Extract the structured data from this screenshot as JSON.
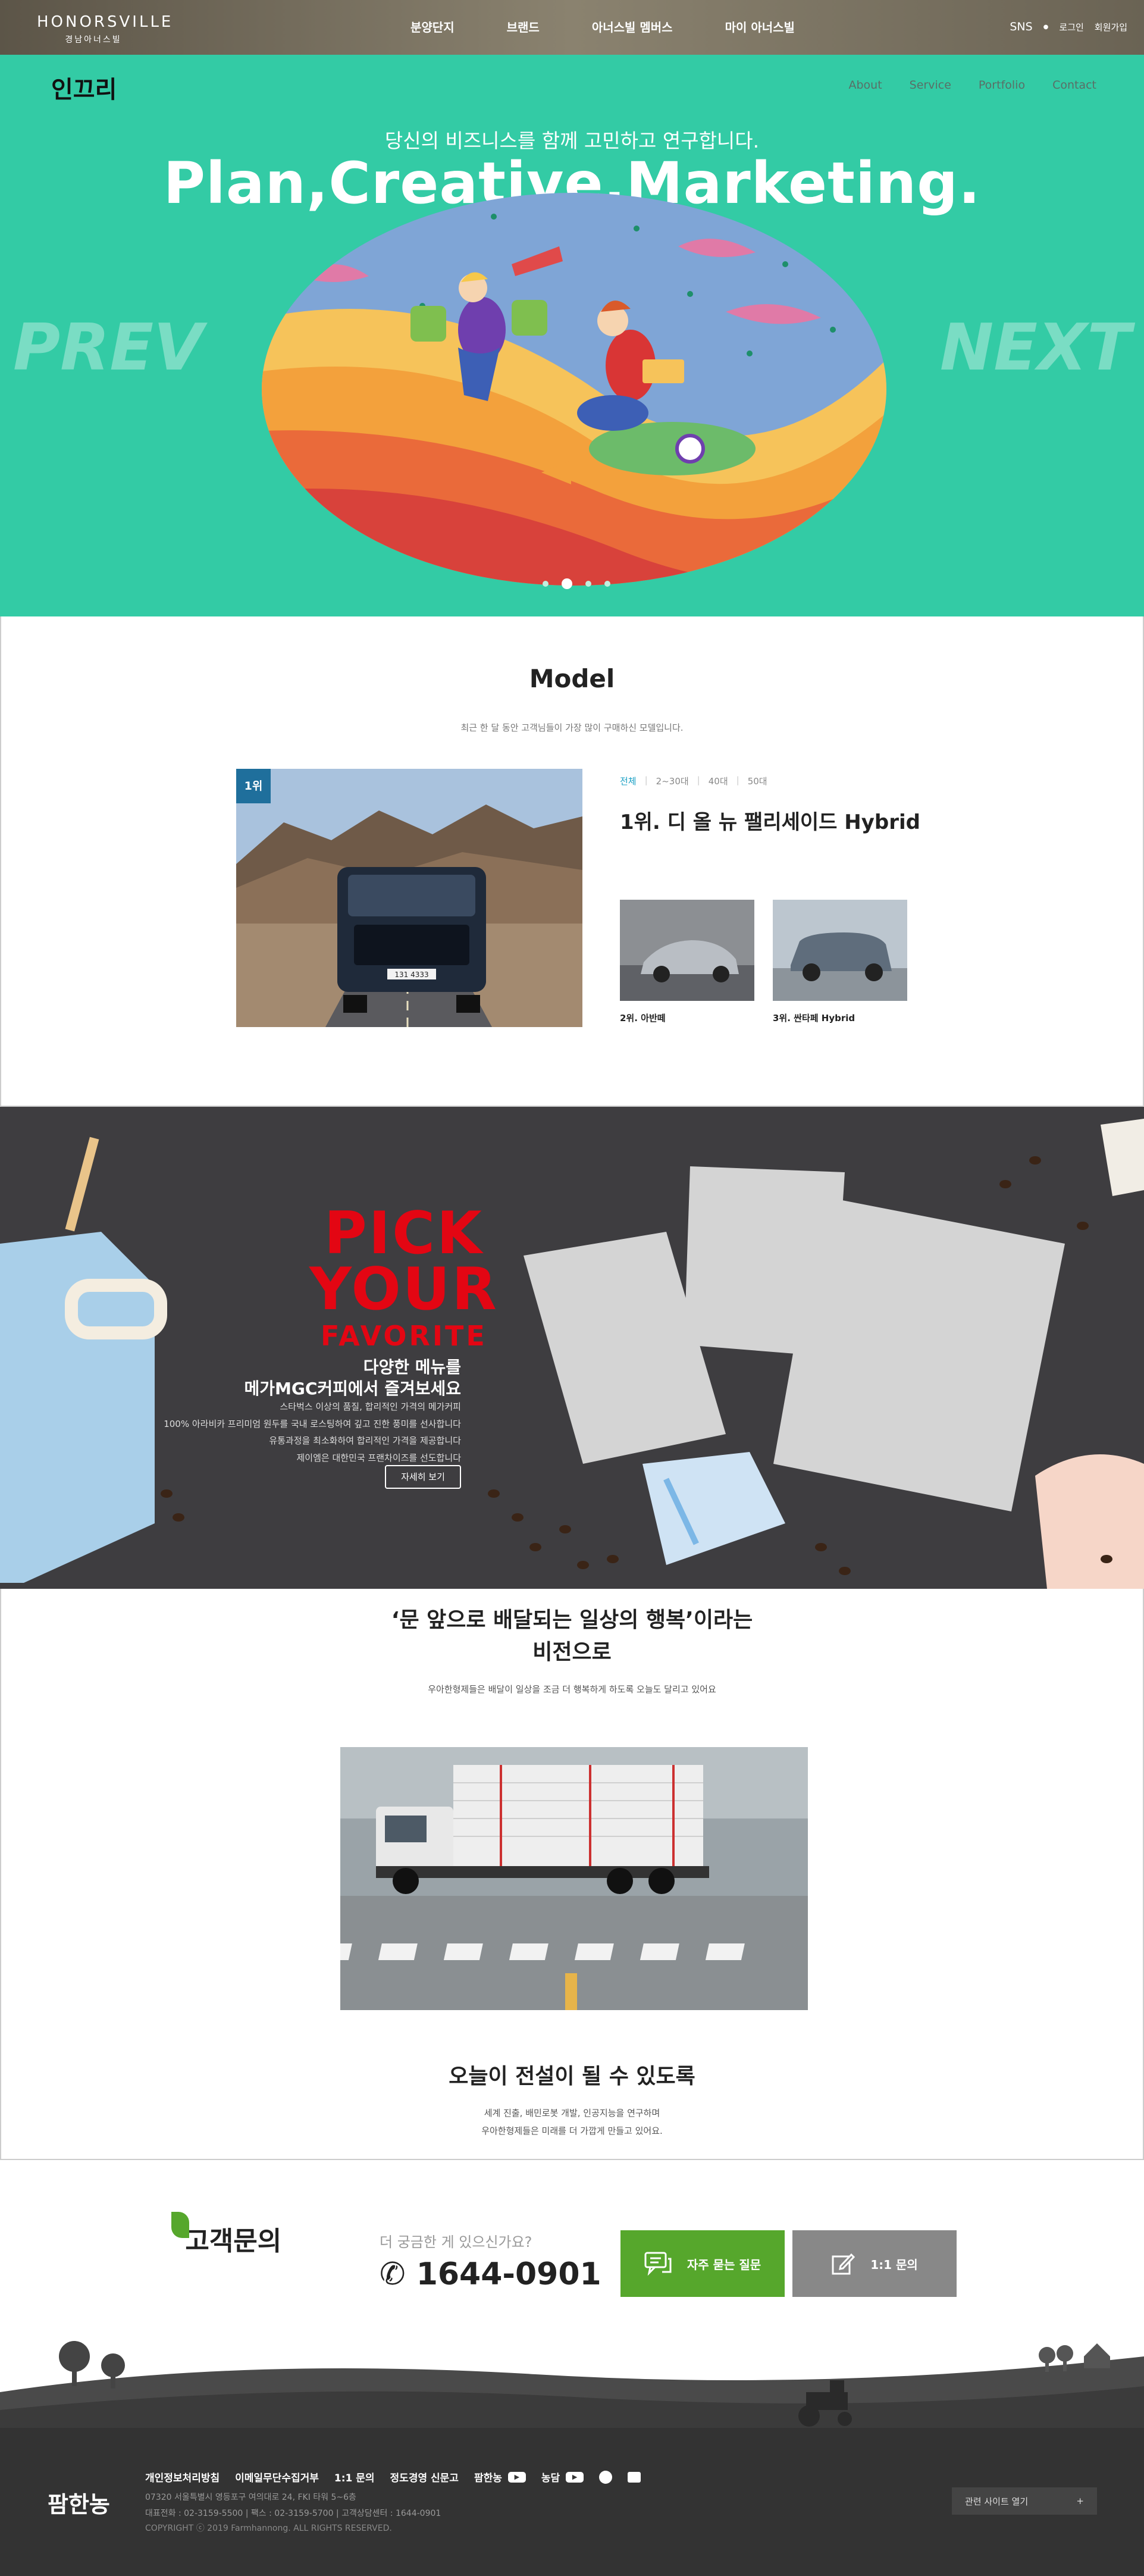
{
  "topbar": {
    "brand_main": "HONORSVILLE",
    "brand_sub": "경남아너스빌",
    "nav": [
      "분양단지",
      "브랜드",
      "아너스빌 멤버스",
      "마이 아너스빌"
    ],
    "util": {
      "sns": "SNS",
      "login": "로그인",
      "join": "회원가입"
    }
  },
  "hero": {
    "logo": "인끄리",
    "nav": [
      "About",
      "Service",
      "Portfolio",
      "Contact"
    ],
    "subtitle": "당신의 비즈니스를 함께 고민하고 연구합니다.",
    "title": "Plan,Creative,Marketing.",
    "prev": "PREV",
    "next": "NEXT",
    "slide_count": 4,
    "active_slide": 2,
    "bg_color": "#33cba5"
  },
  "model": {
    "title": "Model",
    "desc": "최근 한 달 동안 고객님들이 가장 많이 구매하신 모델입니다.",
    "rank_badge": "1위",
    "filters": [
      "전체",
      "2~30대",
      "40대",
      "50대"
    ],
    "active_filter": "전체",
    "top_name": "1위. 디 올 뉴 팰리세이드 Hybrid",
    "plate": "131 4333",
    "thumbs": [
      {
        "caption": "2위. 아반떼"
      },
      {
        "caption": "3위. 싼타페 Hybrid"
      }
    ]
  },
  "promo": {
    "pick1": "PICK",
    "pick2": "YOUR",
    "pick3": "FAVORITE",
    "heading1": "다양한 메뉴를",
    "heading2": "메가MGC커피에서 즐겨보세요",
    "desc1": "스타벅스 이상의 품질, 합리적인 가격의 메가커피",
    "desc2": "100% 아라비카 프리미엄 원두를 국내 로스팅하여 깊고 진한 풍미를 선사합니다",
    "desc3": "유통과정을 최소화하여 합리적인 가격을 제공합니다",
    "desc4": "제이엠은 대한민국 프랜차이즈를 선도합니다",
    "more": "자세히 보기",
    "accent": "#e30613"
  },
  "vision": {
    "title_line1": "‘문 앞으로 배달되는 일상의 행복’이라는",
    "title_line2": "비전으로",
    "desc": "우아한형제들은 배달이 일상을 조금 더 행복하게 하도록 오늘도 달리고 있어요",
    "title2": "오늘이 전설이 될 수 있도록",
    "desc2_line1": "세계 진출, 배민로봇 개발, 인공지능을 연구하며",
    "desc2_line2": "우아한형제들은 미래를 더 가깝게 만들고 있어요."
  },
  "cs": {
    "title": "고객문의",
    "question": "더 궁금한 게 있으신가요?",
    "phone": "1644-0901",
    "faq_label": "자주 묻는 질문",
    "qna_label": "1:1 문의",
    "faq_color": "#56a72c"
  },
  "footer": {
    "logo": "팜한농",
    "links": [
      "개인정보처리방침",
      "이메일무단수집거부",
      "1:1 문의",
      "정도경영 신문고",
      "팜한농",
      "농담"
    ],
    "info1": "07320 서울특별시 영등포구 여의대로 24, FKI 타워 5~6층",
    "info2": "대표전화 : 02-3159-5500   |   팩스 : 02-3159-5700   |   고객상담센터 : 1644-0901",
    "copyright": "COPYRIGHT ⓒ 2019 Farmhannong. ALL RIGHTS RESERVED.",
    "related_sites": "관련 사이트 열기",
    "plus": "+"
  }
}
